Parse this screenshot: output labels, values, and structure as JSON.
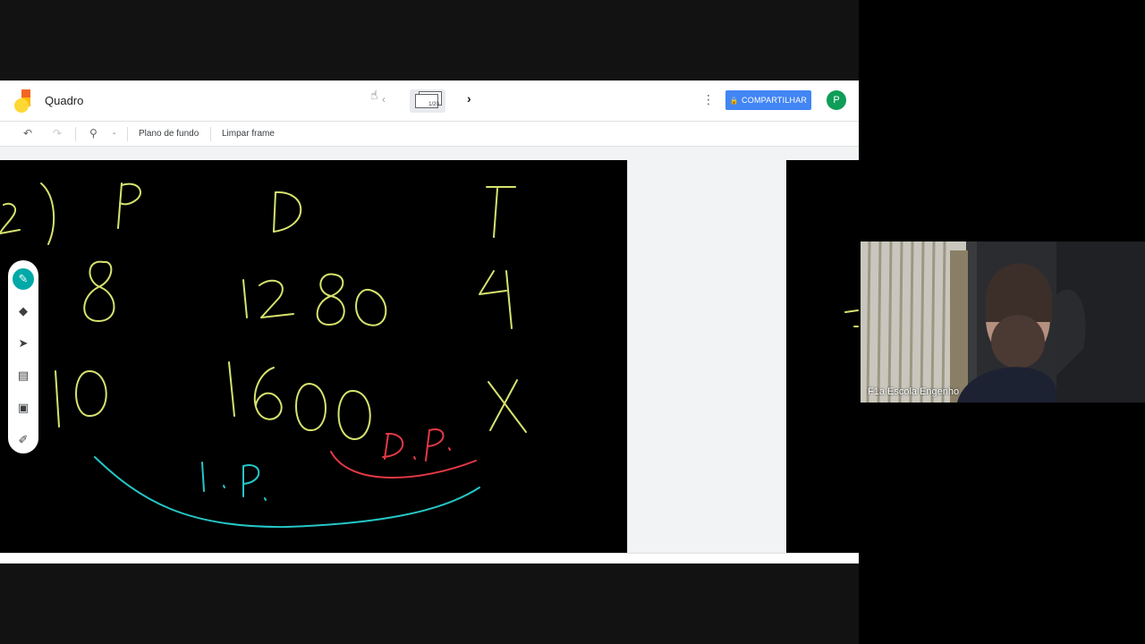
{
  "app": {
    "title": "Quadro",
    "frame_counter": "1/20",
    "share_label": "COMPARTILHAR",
    "avatar_initial": "P",
    "more_icon": "more-vert-icon",
    "colors": {
      "accent": "#4285f4",
      "avatar": "#0f9d58",
      "pen_active": "#00a8a8"
    }
  },
  "toolbar": {
    "undo_icon": "undo-icon",
    "redo_icon": "redo-icon",
    "zoom_icon": "zoom-icon",
    "zoom_dropdown": "-",
    "background_label": "Plano de fundo",
    "clear_label": "Limpar frame"
  },
  "palette": [
    "pen-icon",
    "eraser-icon",
    "select-icon",
    "sticky-note-icon",
    "image-icon",
    "laser-icon"
  ],
  "board": {
    "strokes_yellow": [
      "2)",
      "P",
      "D",
      "T",
      "8",
      "1280",
      "4",
      "10",
      "1600",
      "X"
    ],
    "label_red": "D.P.",
    "label_cyan": "I.P.",
    "colors": {
      "yellow": "#d7e36e",
      "red": "#e53945",
      "cyan": "#26c6c6"
    }
  },
  "video": {
    "participant_name": "F1a Escola Engenho"
  }
}
